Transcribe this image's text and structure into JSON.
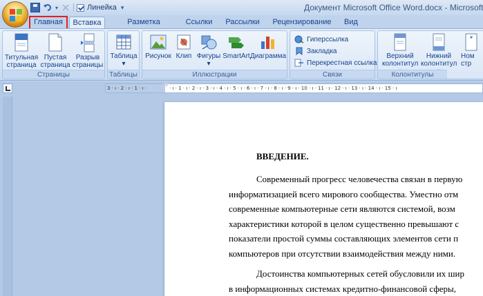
{
  "window": {
    "title": "Документ Microsoft Office Word.docx - Microsoft Word",
    "qat_checkbox_label": "Линейка"
  },
  "tabs": [
    "Главная",
    "Вставка",
    "Разметка страницы",
    "Ссылки",
    "Рассылки",
    "Рецензирование",
    "Вид"
  ],
  "ribbon": {
    "groups": {
      "pages": "Страницы",
      "tables": "Таблицы",
      "illustrations": "Иллюстрации",
      "links": "Связи",
      "headers": "Колонтитулы"
    },
    "buttons": {
      "title_page_1": "Титульная",
      "title_page_2": "страница ▾",
      "blank_page_1": "Пустая",
      "blank_page_2": "страница",
      "page_break_1": "Разрыв",
      "page_break_2": "страницы",
      "table_1": "Таблица",
      "table_2": "▾",
      "picture": "Рисунок",
      "clip": "Клип",
      "shapes": "Фигуры ▾",
      "smartart": "SmartArt",
      "chart": "Диаграмма",
      "header_1": "Верхний",
      "header_2": "колонтитул ▾",
      "footer_1": "Нижний",
      "footer_2": "колонтитул ▾",
      "pagenum_1": "Ном",
      "pagenum_2": "стр"
    },
    "links": [
      "Гиперссылка",
      "Закладка",
      "Перекрестная ссылка"
    ]
  },
  "ruler": {
    "left_ticks": "3 · ı · 2 · ı · 1 · ı ·",
    "right_ticks": "· ı · 1 · ı · 2 · ı · 3 · ı · 4 · ı · 5 · ı · 6 · ı · 7 · ı · 8 · ı · 9 · ı · 10 · ı · 11 · ı · 12 · ı · 13 · ı · 14 · ı · 15 · ı"
  },
  "document": {
    "heading": "ВВЕДЕНИЕ.",
    "lines": [
      "Современный прогресс человечества связан в первую",
      "информатизацией всего мирового сообщества. Уместно отм",
      "современные компьютерные сети являются системой, возм",
      "характеристики которой в целом существенно превышают с",
      "показатели простой суммы составляющих элементов сети п",
      "компьютеров при отсутствии взаимодействия между ними.",
      "Достоинства компьютерных сетей обусловили их шир",
      "в информационных системах кредитно-финансовой сферы,"
    ]
  },
  "colors": {
    "highlight_box": "#e0201e",
    "tab_text": "#15428b"
  }
}
